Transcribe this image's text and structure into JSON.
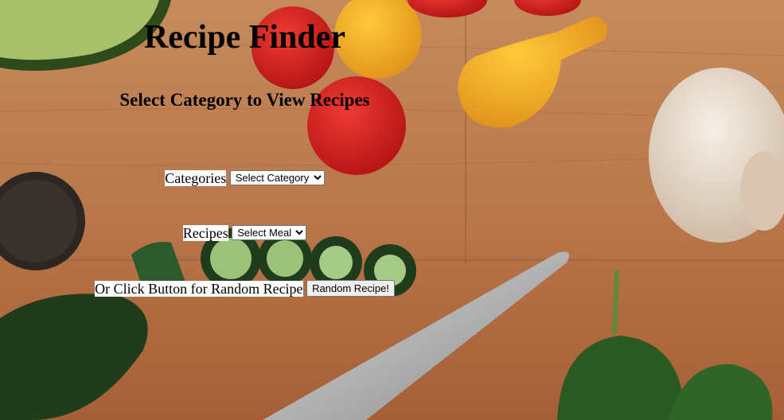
{
  "page": {
    "title": "Recipe Finder",
    "subtitle": "Select Category to View Recipes"
  },
  "categories": {
    "label": "Categories",
    "selected": "Select Category",
    "options": [
      "Select Category"
    ]
  },
  "recipes": {
    "label": "Recipes",
    "selected": "Select Meal",
    "options": [
      "Select Meal"
    ]
  },
  "random": {
    "label": "Or Click Button for Random Recipe",
    "button_label": "Random Recipe!"
  },
  "background": {
    "board_color": "#b9774a",
    "tomato_red": "#d91f1f",
    "tomato_yellow": "#f3a81c",
    "pepper_green": "#1f3d1c",
    "spinach_green": "#2a5a22",
    "mushroom": "#ede3d6"
  }
}
